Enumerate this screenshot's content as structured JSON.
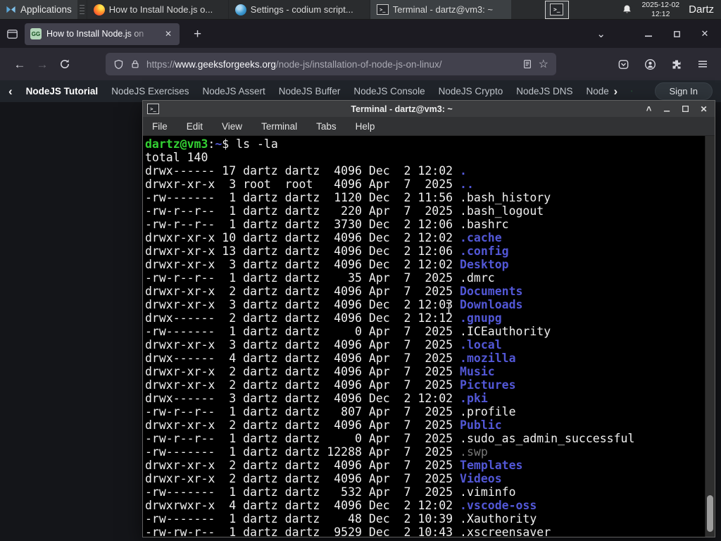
{
  "glyphs": {
    "plus": "+",
    "close": "✕",
    "minimize": "–",
    "chevron_down": "⌄",
    "chevron_left": "‹",
    "chevron_right": "›",
    "back": "←",
    "forward": "→",
    "shade": "˄",
    "star": "☆",
    "term_prompt_icon": ">_",
    "favicon_text": "GG"
  },
  "panel": {
    "applications_label": "Applications",
    "tasks": [
      {
        "icon": "firefox",
        "label": "How to Install Node.js o...",
        "active": false
      },
      {
        "icon": "codium",
        "label": "Settings - codium script...",
        "active": false
      },
      {
        "icon": "terminal",
        "label": "Terminal - dartz@vm3: ~",
        "active": true
      }
    ],
    "clock_date": "2025-12-02",
    "clock_time": "12:12",
    "user": "Dartz"
  },
  "browser": {
    "tab": {
      "title": "How to Install Node.js on"
    },
    "url": {
      "protocol": "https://",
      "domain": "www.geeksforgeeks.org",
      "path": "/node-js/installation-of-node-js-on-linux/"
    }
  },
  "gfg_nav": {
    "links": [
      "NodeJS Tutorial",
      "NodeJS Exercises",
      "NodeJS Assert",
      "NodeJS Buffer",
      "NodeJS Console",
      "NodeJS Crypto",
      "NodeJS DNS",
      "Node"
    ],
    "sign_in": "Sign In"
  },
  "terminal_window": {
    "title": "Terminal - dartz@vm3: ~",
    "menu": [
      "File",
      "Edit",
      "View",
      "Terminal",
      "Tabs",
      "Help"
    ],
    "prompt_segments": [
      {
        "t": "dartz@vm3",
        "c": "green"
      },
      {
        "t": ":",
        "c": "fg"
      },
      {
        "t": "~",
        "c": "blue"
      },
      {
        "t": "$ ",
        "c": "fg"
      },
      {
        "t": "ls -la",
        "c": "fg"
      }
    ],
    "total_line": "total 140",
    "rows": [
      {
        "pre": "drwx------ 17 dartz dartz  4096 Dec  2 12:02 ",
        "name": ".",
        "c": "dir"
      },
      {
        "pre": "drwxr-xr-x  3 root  root   4096 Apr  7  2025 ",
        "name": "..",
        "c": "dir"
      },
      {
        "pre": "-rw-------  1 dartz dartz  1120 Dec  2 11:56 ",
        "name": ".bash_history",
        "c": "fg"
      },
      {
        "pre": "-rw-r--r--  1 dartz dartz   220 Apr  7  2025 ",
        "name": ".bash_logout",
        "c": "fg"
      },
      {
        "pre": "-rw-r--r--  1 dartz dartz  3730 Dec  2 12:06 ",
        "name": ".bashrc",
        "c": "fg"
      },
      {
        "pre": "drwxr-xr-x 10 dartz dartz  4096 Dec  2 12:02 ",
        "name": ".cache",
        "c": "dir"
      },
      {
        "pre": "drwxr-xr-x 13 dartz dartz  4096 Dec  2 12:06 ",
        "name": ".config",
        "c": "dir"
      },
      {
        "pre": "drwxr-xr-x  3 dartz dartz  4096 Dec  2 12:02 ",
        "name": "Desktop",
        "c": "dir"
      },
      {
        "pre": "-rw-r--r--  1 dartz dartz    35 Apr  7  2025 ",
        "name": ".dmrc",
        "c": "fg"
      },
      {
        "pre": "drwxr-xr-x  2 dartz dartz  4096 Apr  7  2025 ",
        "name": "Documents",
        "c": "dir"
      },
      {
        "pre": "drwxr-xr-x  3 dartz dartz  4096 Dec  2 12:03 ",
        "name": "Downloads",
        "c": "dir"
      },
      {
        "pre": "drwx------  2 dartz dartz  4096 Dec  2 12:12 ",
        "name": ".gnupg",
        "c": "dir"
      },
      {
        "pre": "-rw-------  1 dartz dartz     0 Apr  7  2025 ",
        "name": ".ICEauthority",
        "c": "fg"
      },
      {
        "pre": "drwxr-xr-x  3 dartz dartz  4096 Apr  7  2025 ",
        "name": ".local",
        "c": "dir"
      },
      {
        "pre": "drwx------  4 dartz dartz  4096 Apr  7  2025 ",
        "name": ".mozilla",
        "c": "dir"
      },
      {
        "pre": "drwxr-xr-x  2 dartz dartz  4096 Apr  7  2025 ",
        "name": "Music",
        "c": "dir"
      },
      {
        "pre": "drwxr-xr-x  2 dartz dartz  4096 Apr  7  2025 ",
        "name": "Pictures",
        "c": "dir"
      },
      {
        "pre": "drwx------  3 dartz dartz  4096 Dec  2 12:02 ",
        "name": ".pki",
        "c": "dir"
      },
      {
        "pre": "-rw-r--r--  1 dartz dartz   807 Apr  7  2025 ",
        "name": ".profile",
        "c": "fg"
      },
      {
        "pre": "drwxr-xr-x  2 dartz dartz  4096 Apr  7  2025 ",
        "name": "Public",
        "c": "dir"
      },
      {
        "pre": "-rw-r--r--  1 dartz dartz     0 Apr  7  2025 ",
        "name": ".sudo_as_admin_successful",
        "c": "fg"
      },
      {
        "pre": "-rw-------  1 dartz dartz 12288 Apr  7  2025 ",
        "name": ".swp",
        "c": "dim"
      },
      {
        "pre": "drwxr-xr-x  2 dartz dartz  4096 Apr  7  2025 ",
        "name": "Templates",
        "c": "dir"
      },
      {
        "pre": "drwxr-xr-x  2 dartz dartz  4096 Apr  7  2025 ",
        "name": "Videos",
        "c": "dir"
      },
      {
        "pre": "-rw-------  1 dartz dartz   532 Apr  7  2025 ",
        "name": ".viminfo",
        "c": "fg"
      },
      {
        "pre": "drwxrwxr-x  4 dartz dartz  4096 Dec  2 12:02 ",
        "name": ".vscode-oss",
        "c": "dir"
      },
      {
        "pre": "-rw-------  1 dartz dartz    48 Dec  2 10:39 ",
        "name": ".Xauthority",
        "c": "fg"
      },
      {
        "pre": "-rw-rw-r--  1 dartz dartz  9529 Dec  2 10:43 ",
        "name": ".xscreensaver",
        "c": "fg"
      }
    ]
  },
  "colors": {
    "gfg_green": "#2f8d46",
    "terminal_dir_blue": "#5257d6",
    "terminal_prompt_green": "#33d133"
  }
}
